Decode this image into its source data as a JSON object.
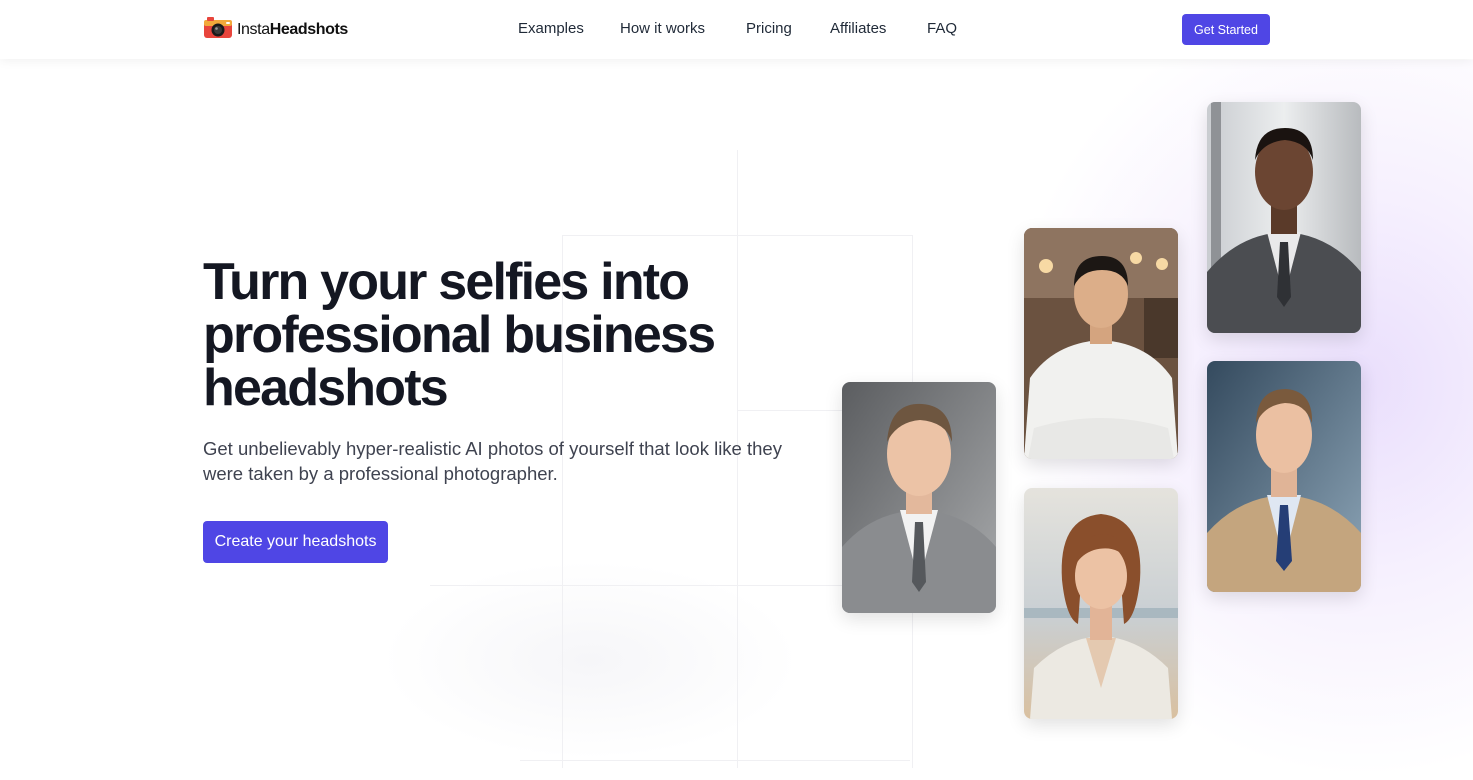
{
  "header": {
    "logo": {
      "text_light": "Insta",
      "text_bold": "Headshots",
      "icon": "camera-icon"
    },
    "nav": [
      {
        "label": "Examples"
      },
      {
        "label": "How it works"
      },
      {
        "label": "Pricing"
      },
      {
        "label": "Affiliates"
      },
      {
        "label": "FAQ"
      }
    ],
    "cta_label": "Get Started"
  },
  "hero": {
    "headline": "Turn your selfies into professional business headshots",
    "subheadline": "Get unbelievably hyper-realistic AI photos of yourself that look like they were taken by a professional photographer.",
    "cta_label": "Create your headshots"
  },
  "photos": [
    {
      "name": "headshot-man-gray-suit"
    },
    {
      "name": "headshot-man-white-shirt-cafe"
    },
    {
      "name": "headshot-woman-beach"
    },
    {
      "name": "headshot-man-dark-suit"
    },
    {
      "name": "headshot-man-tan-blazer"
    }
  ],
  "colors": {
    "accent": "#4f46e5",
    "text_dark": "#141722",
    "text_body": "#3f4350",
    "glow": "#d8c4fa"
  }
}
